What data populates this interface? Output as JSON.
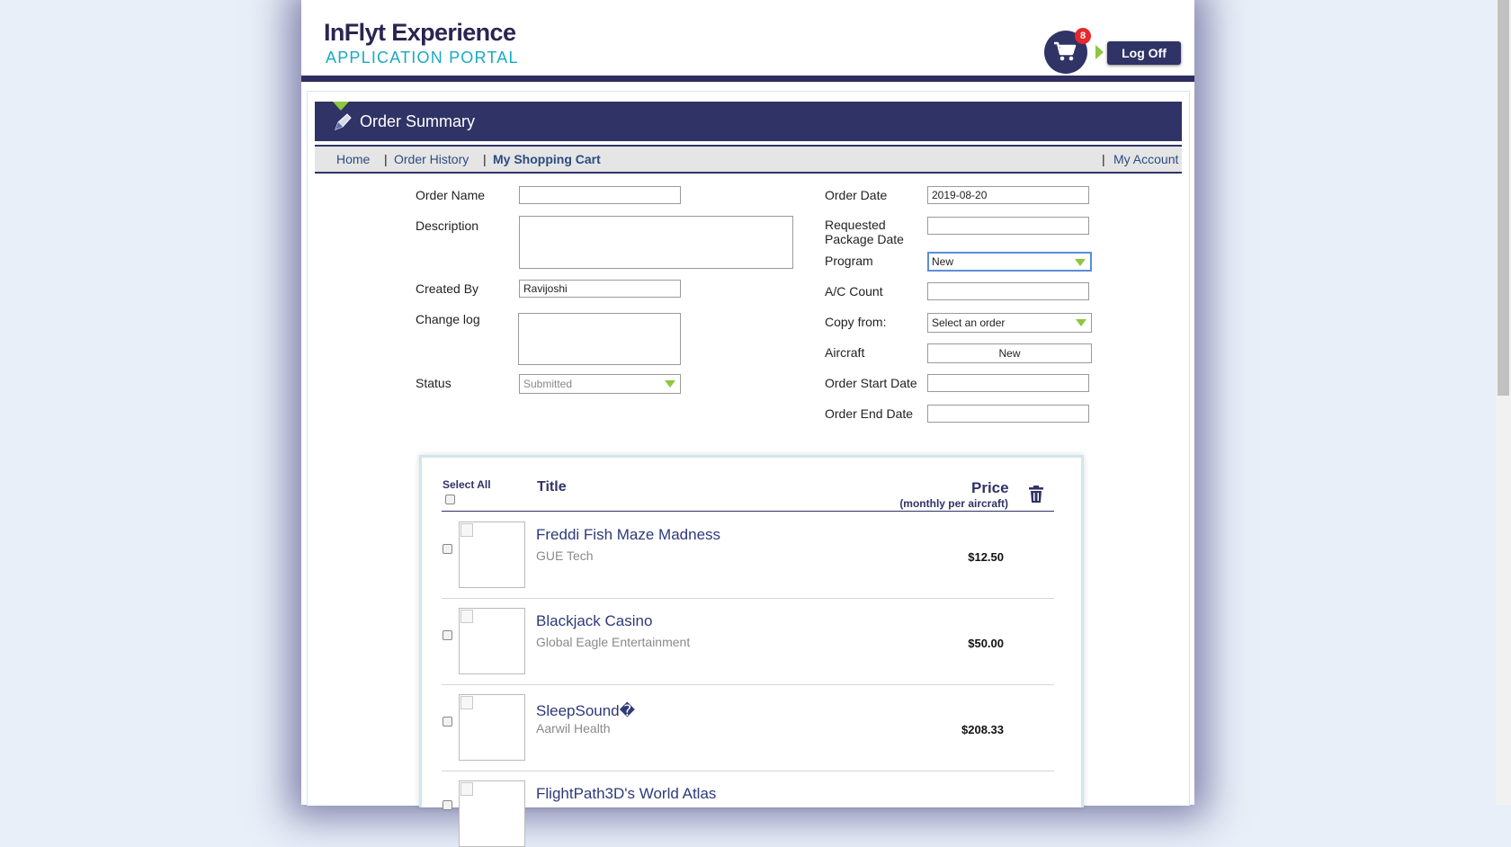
{
  "header": {
    "logo_title": "InFlyt Experience",
    "logo_subtitle": "APPLICATION PORTAL",
    "cart_count": "8",
    "logoff_label": "Log Off"
  },
  "page": {
    "title": "Order Summary"
  },
  "nav": {
    "home": "Home",
    "order_history": "Order History",
    "shopping_cart": "My Shopping Cart",
    "my_account": "My Account",
    "separator": "|"
  },
  "form": {
    "order_name_label": "Order Name",
    "order_name_value": "",
    "description_label": "Description",
    "created_by_label": "Created By",
    "created_by_value": "Ravijoshi",
    "change_log_label": "Change log",
    "status_label": "Status",
    "status_value": "Submitted",
    "order_date_label": "Order Date",
    "order_date_value": "2019-08-20",
    "requested_package_label_1": "Requested",
    "requested_package_label_2": "Package Date",
    "program_label": "Program",
    "program_value": "New",
    "ac_count_label": "A/C Count",
    "copy_from_label": "Copy from:",
    "copy_from_value": "Select an order",
    "aircraft_label": "Aircraft",
    "aircraft_button": "New",
    "order_start_label": "Order Start Date",
    "order_end_label": "Order End Date"
  },
  "cart": {
    "select_all": "Select All",
    "title_header": "Title",
    "price_header": "Price",
    "price_subheader": "(monthly per aircraft)",
    "items": [
      {
        "title": "Freddi Fish Maze Madness",
        "vendor": "GUE Tech",
        "price": "$12.50"
      },
      {
        "title": "Blackjack Casino",
        "vendor": "Global Eagle Entertainment",
        "price": "$50.00"
      },
      {
        "title": "SleepSound�",
        "vendor": "Aarwil Health",
        "price": "$208.33"
      },
      {
        "title": "FlightPath3D's World Atlas",
        "vendor": "",
        "price": ""
      }
    ]
  },
  "colors": {
    "navy": "#303366",
    "accent_green": "#8dc63f",
    "accent_cyan": "#19a9c2",
    "badge_red": "#e8282a",
    "link_blue": "#2a4c80"
  },
  "icons": {
    "cart": "shopping-cart-icon",
    "title": "pen-icon",
    "delete": "trash-icon",
    "dropdown": "chevron-down-icon"
  }
}
